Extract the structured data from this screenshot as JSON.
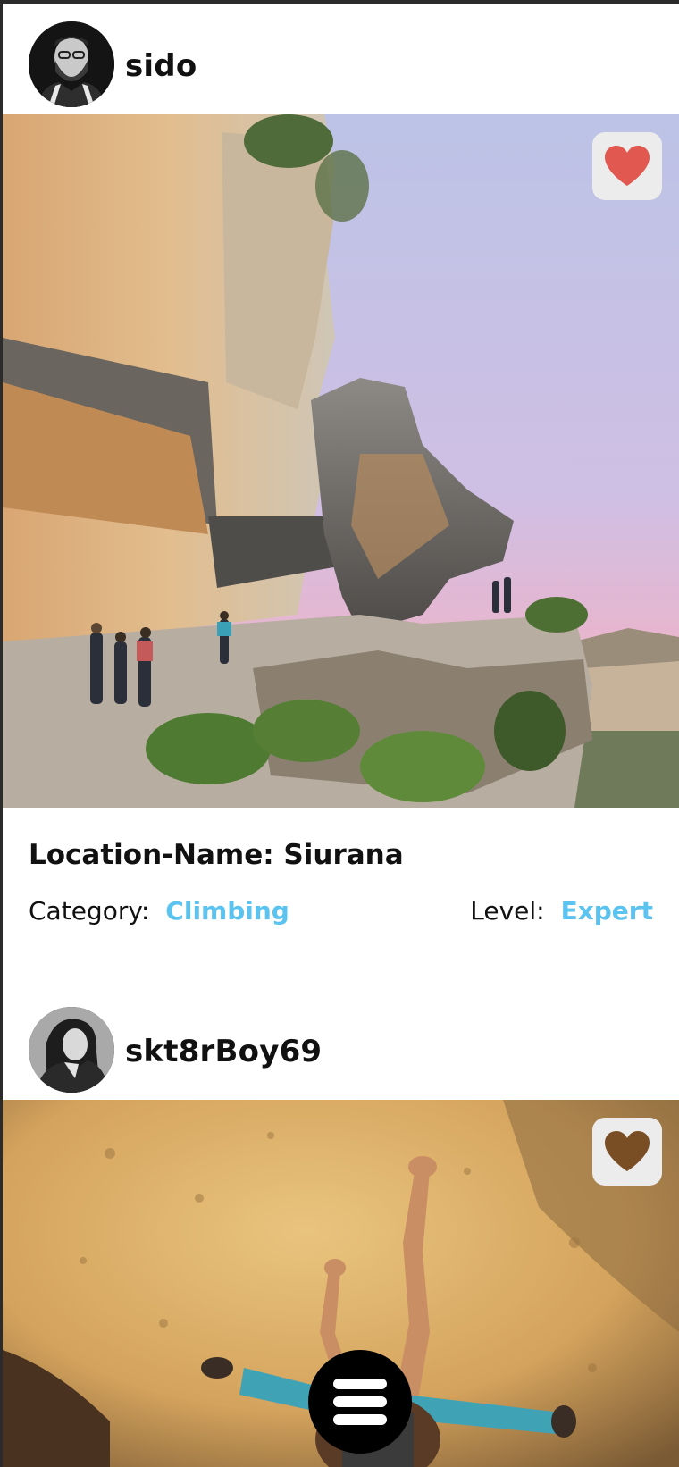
{
  "posts": [
    {
      "username": "sido",
      "avatar_icon": "user-avatar-icon",
      "liked": true,
      "like_icon": "heart-icon",
      "location_label": "Location-Name:",
      "location_name": "Siurana",
      "category_label": "Category:",
      "category_value": "Climbing",
      "level_label": "Level:",
      "level_value": "Expert"
    },
    {
      "username": "skt8rBoy69",
      "avatar_icon": "user-avatar-icon",
      "liked": false,
      "like_icon": "heart-icon"
    }
  ],
  "colors": {
    "accent": "#5bc3ef",
    "liked_heart": "#e0584f",
    "unliked_heart": "#7a4e24",
    "like_button_bg": "#ececec",
    "fab_bg": "#000000"
  },
  "menu_button": {
    "icon": "hamburger-menu-icon"
  }
}
